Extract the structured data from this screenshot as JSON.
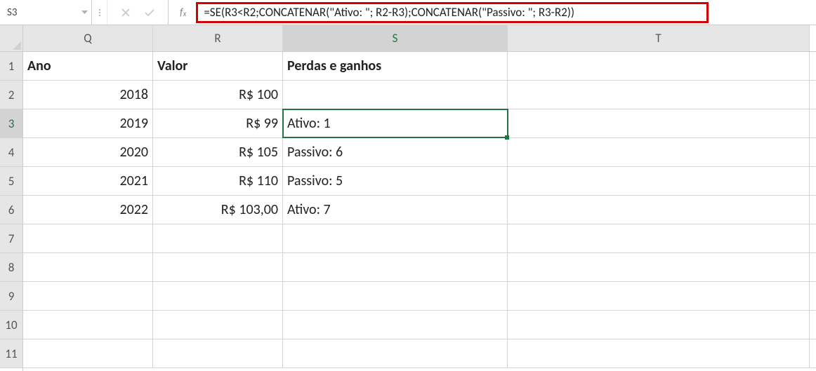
{
  "nameBox": "S3",
  "formula": "=SE(R3<R2;CONCATENAR(\"Ativo: \"; R2-R3);CONCATENAR(\"Passivo: \"; R3-R2))",
  "colHeaders": {
    "Q": "Q",
    "R": "R",
    "S": "S",
    "T": "T"
  },
  "rowHeaders": [
    "1",
    "2",
    "3",
    "4",
    "5",
    "6",
    "7",
    "8",
    "9",
    "10",
    "11"
  ],
  "headers": {
    "Q": "Ano",
    "R": "Valor",
    "S": "Perdas e ganhos"
  },
  "data": [
    {
      "ano": "2018",
      "valor": "R$ 100",
      "pg": ""
    },
    {
      "ano": "2019",
      "valor": "R$ 99",
      "pg": "Ativo: 1"
    },
    {
      "ano": "2020",
      "valor": "R$ 105",
      "pg": "Passivo: 6"
    },
    {
      "ano": "2021",
      "valor": "R$ 110",
      "pg": "Passivo: 5"
    },
    {
      "ano": "2022",
      "valor": "R$ 103,00",
      "pg": "Ativo: 7"
    }
  ],
  "selectedCell": "S3"
}
